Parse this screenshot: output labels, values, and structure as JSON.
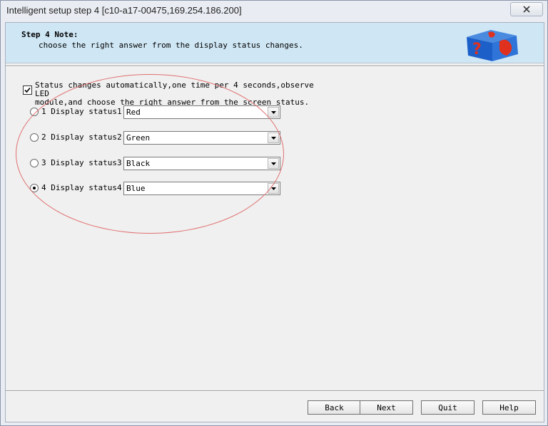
{
  "window": {
    "title": "Intelligent setup step 4 [c10-a17-00475,169.254.186.200]"
  },
  "header": {
    "step_title": "Step 4 Note:",
    "note": "choose the right answer from the display status changes.",
    "icon": "question-cube-icon"
  },
  "auto": {
    "checked": true,
    "line1": "Status changes automatically,one time per 4 seconds,observe LED",
    "line2": "module,and choose the right answer from the screen status."
  },
  "statuses": [
    {
      "label": "1 Display status1:",
      "value": "Red",
      "selected": false
    },
    {
      "label": "2 Display status2:",
      "value": "Green",
      "selected": false
    },
    {
      "label": "3 Display status3:",
      "value": "Black",
      "selected": false
    },
    {
      "label": "4 Display status4:",
      "value": "Blue",
      "selected": true
    }
  ],
  "buttons": {
    "back": "Back",
    "next": "Next",
    "quit": "Quit",
    "help": "Help"
  },
  "colors": {
    "header_bg": "#cfe7f5",
    "annotation": "#e07070"
  }
}
